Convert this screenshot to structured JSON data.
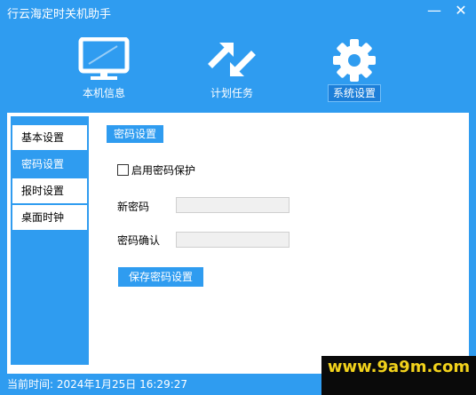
{
  "window": {
    "title": "行云海定时关机助手",
    "minimize_glyph": "—",
    "close_glyph": "✕"
  },
  "nav": {
    "items": [
      {
        "label": "本机信息",
        "icon": "monitor-icon"
      },
      {
        "label": "计划任务",
        "icon": "arrows-icon"
      },
      {
        "label": "系统设置",
        "icon": "gear-icon",
        "active": true
      }
    ]
  },
  "sidebar": {
    "items": [
      {
        "label": "基本设置"
      },
      {
        "label": "密码设置",
        "active": true
      },
      {
        "label": "报时设置"
      },
      {
        "label": "桌面时钟"
      }
    ]
  },
  "content": {
    "section_title": "密码设置",
    "enable_label": "启用密码保护",
    "enable_checked": false,
    "new_password_label": "新密码",
    "new_password_value": "",
    "confirm_label": "密码确认",
    "confirm_value": "",
    "save_label": "保存密码设置"
  },
  "status": {
    "text": "当前时间: 2024年1月25日  16:29:27"
  },
  "watermark": {
    "text": "www.9a9m.com"
  },
  "colors": {
    "accent": "#2f9cf0",
    "panel": "#ffffff",
    "watermark_text": "#f2d21b"
  }
}
